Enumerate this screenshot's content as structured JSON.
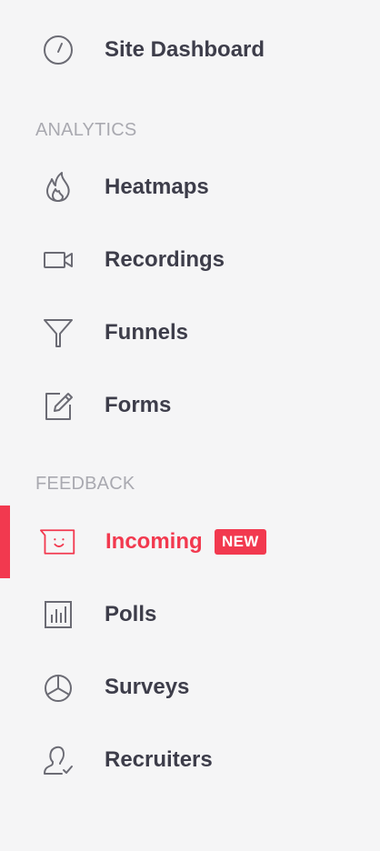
{
  "nav": {
    "site_dashboard": "Site Dashboard",
    "analytics_header": "ANALYTICS",
    "heatmaps": "Heatmaps",
    "recordings": "Recordings",
    "funnels": "Funnels",
    "forms": "Forms",
    "feedback_header": "FEEDBACK",
    "incoming": "Incoming",
    "incoming_badge": "NEW",
    "polls": "Polls",
    "surveys": "Surveys",
    "recruiters": "Recruiters"
  },
  "icons": {
    "site_dashboard": "gauge-icon",
    "heatmaps": "flame-icon",
    "recordings": "video-camera-icon",
    "funnels": "funnel-icon",
    "forms": "edit-form-icon",
    "incoming": "smiley-chat-icon",
    "polls": "bar-chart-icon",
    "surveys": "pie-chart-icon",
    "recruiters": "user-check-icon"
  },
  "colors": {
    "accent": "#f2394f",
    "text": "#3d3d4a",
    "section_header": "#a9a9b0",
    "icon": "#6b6b74",
    "background": "#f5f5f6"
  },
  "active_item": "incoming"
}
